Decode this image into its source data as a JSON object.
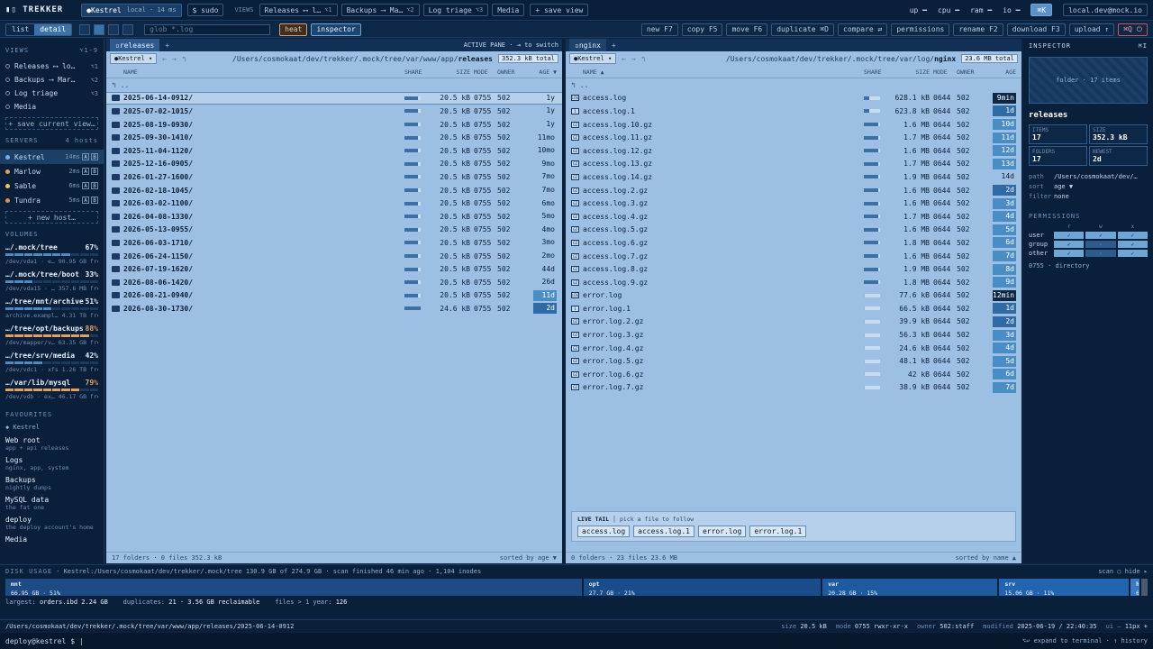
{
  "app": {
    "name": "TREKKER"
  },
  "topbar": {
    "host": "Kestrel",
    "host_mode": "local · 14 ms",
    "sudo": "$ sudo",
    "views_label": "VIEWS",
    "views": [
      {
        "label": "Releases ⟷ l…",
        "key": "⌥1"
      },
      {
        "label": "Backups ⟶ Ma…",
        "key": "⌥2"
      },
      {
        "label": "Log triage",
        "key": "⌥3"
      },
      {
        "label": "Media",
        "key": ""
      }
    ],
    "save_view": "+ save view",
    "meters": [
      "up",
      "cpu",
      "ram",
      "io"
    ],
    "cmdk": "⌘K",
    "account": "local.dev@mock.io"
  },
  "toolbar": {
    "modes": [
      "list",
      "detail"
    ],
    "glob_placeholder": "glob *.log",
    "heat": "heat",
    "inspector": "inspector",
    "actions": [
      "new F7",
      "copy F5",
      "move F6",
      "duplicate ⌘D",
      "compare ⇄",
      "permissions",
      "rename F2",
      "download F3",
      "upload ↑"
    ],
    "quit": "⌘Q ⏻"
  },
  "sidebar": {
    "views_title": "VIEWS",
    "views_keys": "⌥1-9",
    "views": [
      {
        "label": "Releases ⟷ lo…",
        "key": "⌥1"
      },
      {
        "label": "Backups ⟶ Mar…",
        "key": "⌥2"
      },
      {
        "label": "Log triage",
        "key": "⌥3"
      },
      {
        "label": "Media",
        "key": ""
      }
    ],
    "save_view": "+ save current view…",
    "servers_title": "SERVERS",
    "servers_count": "4 hosts",
    "servers": [
      {
        "name": "Kestrel",
        "lat": "14ms",
        "color": "#6fb0e8",
        "active": true
      },
      {
        "name": "Marlow",
        "lat": "2ms",
        "color": "#e0a060",
        "active": false
      },
      {
        "name": "Sable",
        "lat": "6ms",
        "color": "#e6c86e",
        "active": false
      },
      {
        "name": "Tundra",
        "lat": "5ms",
        "color": "#e08c5a",
        "active": false
      }
    ],
    "new_host": "+ new host…",
    "volumes_title": "VOLUMES",
    "volumes": [
      {
        "path": "…/.mock/tree",
        "pct": "67%",
        "fill": 0.67,
        "sub": "/dev/vda1 · e… 90.95 GB free",
        "color": "#4a8cc4",
        "warn": false
      },
      {
        "path": "…/.mock/tree/boot",
        "pct": "33%",
        "fill": 0.33,
        "sub": "/dev/vda15 · … 357.6 MB free",
        "color": "#4a8cc4",
        "warn": false
      },
      {
        "path": "…/tree/mnt/archive",
        "pct": "51%",
        "fill": 0.51,
        "sub": "archive.exampl… 4.31 TB free",
        "color": "#4a8cc4",
        "warn": false
      },
      {
        "path": "…/tree/opt/backups",
        "pct": "88%",
        "fill": 0.88,
        "sub": "/dev/mapper/v… 63.35 GB free",
        "color": "#e0a060",
        "warn": true
      },
      {
        "path": "…/tree/srv/media",
        "pct": "42%",
        "fill": 0.42,
        "sub": "/dev/vdc1 · xfs 1.26 TB free",
        "color": "#4a8cc4",
        "warn": false
      },
      {
        "path": "…/var/lib/mysql",
        "pct": "79%",
        "fill": 0.79,
        "sub": "/dev/vdb · ex… 46.17 GB free",
        "color": "#e0a060",
        "warn": true
      }
    ],
    "fav_title": "FAVOURITES",
    "fav_host": "◆ Kestrel",
    "favourites": [
      {
        "t": "Web root",
        "s": "app + api releases"
      },
      {
        "t": "Logs",
        "s": "nginx, app, system"
      },
      {
        "t": "Backups",
        "s": "nightly dumps"
      },
      {
        "t": "MySQL data",
        "s": "the fat one"
      },
      {
        "t": "deploy",
        "s": "the deploy account's home"
      },
      {
        "t": "Media",
        "s": ""
      }
    ]
  },
  "left": {
    "tab": "releases",
    "active_label": "ACTIVE PANE · ⇥ to switch",
    "host": "Kestrel",
    "path_prefix": "/Users/cosmokaat/dev/trekker/.mock/tree/var/www/app/",
    "path_leaf": "releases",
    "total": "352.3 kB total",
    "cols": {
      "name": "NAME",
      "share": "SHARE",
      "size": "SIZE",
      "mode": "MODE",
      "owner": "OWNER",
      "age": "AGE ▼"
    },
    "parent": "↰ ..",
    "rows": [
      {
        "n": "2025-06-14-0912/",
        "s": 0.85,
        "z": "20.5 kB",
        "m": "0755",
        "o": "502",
        "a": "1y",
        "h": "",
        "sel": true
      },
      {
        "n": "2025-07-02-1015/",
        "s": 0.85,
        "z": "20.5 kB",
        "m": "0755",
        "o": "502",
        "a": "1y",
        "h": ""
      },
      {
        "n": "2025-08-19-0930/",
        "s": 0.85,
        "z": "20.5 kB",
        "m": "0755",
        "o": "502",
        "a": "1y",
        "h": ""
      },
      {
        "n": "2025-09-30-1410/",
        "s": 0.85,
        "z": "20.5 kB",
        "m": "0755",
        "o": "502",
        "a": "11mo",
        "h": ""
      },
      {
        "n": "2025-11-04-1120/",
        "s": 0.85,
        "z": "20.5 kB",
        "m": "0755",
        "o": "502",
        "a": "10mo",
        "h": ""
      },
      {
        "n": "2025-12-16-0905/",
        "s": 0.85,
        "z": "20.5 kB",
        "m": "0755",
        "o": "502",
        "a": "9mo",
        "h": ""
      },
      {
        "n": "2026-01-27-1600/",
        "s": 0.85,
        "z": "20.5 kB",
        "m": "0755",
        "o": "502",
        "a": "7mo",
        "h": ""
      },
      {
        "n": "2026-02-18-1045/",
        "s": 0.85,
        "z": "20.5 kB",
        "m": "0755",
        "o": "502",
        "a": "7mo",
        "h": ""
      },
      {
        "n": "2026-03-02-1100/",
        "s": 0.85,
        "z": "20.5 kB",
        "m": "0755",
        "o": "502",
        "a": "6mo",
        "h": ""
      },
      {
        "n": "2026-04-08-1330/",
        "s": 0.85,
        "z": "20.5 kB",
        "m": "0755",
        "o": "502",
        "a": "5mo",
        "h": ""
      },
      {
        "n": "2026-05-13-0955/",
        "s": 0.85,
        "z": "20.5 kB",
        "m": "0755",
        "o": "502",
        "a": "4mo",
        "h": ""
      },
      {
        "n": "2026-06-03-1710/",
        "s": 0.85,
        "z": "20.5 kB",
        "m": "0755",
        "o": "502",
        "a": "3mo",
        "h": ""
      },
      {
        "n": "2026-06-24-1150/",
        "s": 0.85,
        "z": "20.5 kB",
        "m": "0755",
        "o": "502",
        "a": "2mo",
        "h": ""
      },
      {
        "n": "2026-07-19-1620/",
        "s": 0.85,
        "z": "20.5 kB",
        "m": "0755",
        "o": "502",
        "a": "44d",
        "h": ""
      },
      {
        "n": "2026-08-06-1420/",
        "s": 0.85,
        "z": "20.5 kB",
        "m": "0755",
        "o": "502",
        "a": "26d",
        "h": ""
      },
      {
        "n": "2026-08-21-0940/",
        "s": 0.85,
        "z": "20.5 kB",
        "m": "0755",
        "o": "502",
        "a": "11d",
        "h": "h2"
      },
      {
        "n": "2026-08-30-1730/",
        "s": 1.0,
        "z": "24.6 kB",
        "m": "0755",
        "o": "502",
        "a": "2d",
        "h": "h3"
      }
    ],
    "footer": "17 folders · 0 files  352.3 kB",
    "sort": "sorted by age ▼"
  },
  "right": {
    "tab": "nginx",
    "host": "Kestrel",
    "path_prefix": "/Users/cosmokaat/dev/trekker/.mock/tree/var/log/",
    "path_leaf": "nginx",
    "total": "23.6 MB total",
    "cols": {
      "name": "NAME ▲",
      "share": "SHARE",
      "size": "SIZE",
      "mode": "MODE",
      "owner": "OWNER",
      "age": "AGE"
    },
    "parent": "↰ ..",
    "rows": [
      {
        "n": "access.log",
        "s": 0.35,
        "z": "628.1 kB",
        "m": "0644",
        "o": "502",
        "a": "9min",
        "h": "h4",
        "i": "LOG"
      },
      {
        "n": "access.log.1",
        "s": 0.35,
        "z": "623.8 kB",
        "m": "0644",
        "o": "502",
        "a": "1d",
        "h": "h3",
        "i": "1"
      },
      {
        "n": "access.log.10.gz",
        "s": 0.9,
        "z": "1.6 MB",
        "m": "0644",
        "o": "502",
        "a": "10d",
        "h": "h2",
        "i": "GZ"
      },
      {
        "n": "access.log.11.gz",
        "s": 0.9,
        "z": "1.7 MB",
        "m": "0644",
        "o": "502",
        "a": "11d",
        "h": "h2",
        "i": "GZ"
      },
      {
        "n": "access.log.12.gz",
        "s": 0.9,
        "z": "1.6 MB",
        "m": "0644",
        "o": "502",
        "a": "12d",
        "h": "h2",
        "i": "GZ"
      },
      {
        "n": "access.log.13.gz",
        "s": 0.9,
        "z": "1.7 MB",
        "m": "0644",
        "o": "502",
        "a": "13d",
        "h": "h2",
        "i": "GZ"
      },
      {
        "n": "access.log.14.gz",
        "s": 0.9,
        "z": "1.9 MB",
        "m": "0644",
        "o": "502",
        "a": "14d",
        "h": "",
        "i": "GZ"
      },
      {
        "n": "access.log.2.gz",
        "s": 0.9,
        "z": "1.6 MB",
        "m": "0644",
        "o": "502",
        "a": "2d",
        "h": "h3",
        "i": "GZ"
      },
      {
        "n": "access.log.3.gz",
        "s": 0.9,
        "z": "1.6 MB",
        "m": "0644",
        "o": "502",
        "a": "3d",
        "h": "h2",
        "i": "GZ"
      },
      {
        "n": "access.log.4.gz",
        "s": 0.9,
        "z": "1.7 MB",
        "m": "0644",
        "o": "502",
        "a": "4d",
        "h": "h2",
        "i": "GZ"
      },
      {
        "n": "access.log.5.gz",
        "s": 0.9,
        "z": "1.6 MB",
        "m": "0644",
        "o": "502",
        "a": "5d",
        "h": "h2",
        "i": "GZ"
      },
      {
        "n": "access.log.6.gz",
        "s": 0.9,
        "z": "1.8 MB",
        "m": "0644",
        "o": "502",
        "a": "6d",
        "h": "h2",
        "i": "GZ"
      },
      {
        "n": "access.log.7.gz",
        "s": 0.9,
        "z": "1.6 MB",
        "m": "0644",
        "o": "502",
        "a": "7d",
        "h": "h2",
        "i": "GZ"
      },
      {
        "n": "access.log.8.gz",
        "s": 0.9,
        "z": "1.9 MB",
        "m": "0644",
        "o": "502",
        "a": "8d",
        "h": "h2",
        "i": "GZ"
      },
      {
        "n": "access.log.9.gz",
        "s": 0.9,
        "z": "1.8 MB",
        "m": "0644",
        "o": "502",
        "a": "9d",
        "h": "h2",
        "i": "GZ"
      },
      {
        "n": "error.log",
        "s": 0.08,
        "z": "77.6 kB",
        "m": "0644",
        "o": "502",
        "a": "12min",
        "h": "h4",
        "i": "LOG"
      },
      {
        "n": "error.log.1",
        "s": 0.08,
        "z": "66.5 kB",
        "m": "0644",
        "o": "502",
        "a": "1d",
        "h": "h3",
        "i": "1"
      },
      {
        "n": "error.log.2.gz",
        "s": 0.08,
        "z": "39.9 kB",
        "m": "0644",
        "o": "502",
        "a": "2d",
        "h": "h3",
        "i": "GZ"
      },
      {
        "n": "error.log.3.gz",
        "s": 0.08,
        "z": "56.3 kB",
        "m": "0644",
        "o": "502",
        "a": "3d",
        "h": "h2",
        "i": "GZ"
      },
      {
        "n": "error.log.4.gz",
        "s": 0.08,
        "z": "24.6 kB",
        "m": "0644",
        "o": "502",
        "a": "4d",
        "h": "h2",
        "i": "GZ"
      },
      {
        "n": "error.log.5.gz",
        "s": 0.08,
        "z": "48.1 kB",
        "m": "0644",
        "o": "502",
        "a": "5d",
        "h": "h2",
        "i": "GZ"
      },
      {
        "n": "error.log.6.gz",
        "s": 0.08,
        "z": "42 kB",
        "m": "0644",
        "o": "502",
        "a": "6d",
        "h": "h2",
        "i": "GZ"
      },
      {
        "n": "error.log.7.gz",
        "s": 0.08,
        "z": "38.9 kB",
        "m": "0644",
        "o": "502",
        "a": "7d",
        "h": "h2",
        "i": "GZ"
      }
    ],
    "livetail": {
      "title": "LIVE TAIL",
      "hint": "pick a file to follow",
      "files": [
        "access.log",
        "access.log.1",
        "error.log",
        "error.log.1"
      ]
    },
    "footer": "0 folders · 23 files  23.6 MB",
    "sort": "sorted by name ▲"
  },
  "inspector": {
    "title": "INSPECTOR",
    "key": "⌘I",
    "preview": "folder · 17 items",
    "name": "releases",
    "stats": [
      {
        "l": "ITEMS",
        "v": "17"
      },
      {
        "l": "SIZE",
        "v": "352.3 kB"
      },
      {
        "l": "FOLDERS",
        "v": "17"
      },
      {
        "l": "NEWEST",
        "v": "2d"
      }
    ],
    "path_k": "path",
    "path_v": "/Users/cosmokaat/dev/…",
    "sort_k": "sort",
    "sort_v": "age ▼",
    "filter_k": "filter",
    "filter_v": "none",
    "perm_title": "PERMISSIONS",
    "perm_cols": [
      "r",
      "w",
      "x"
    ],
    "perms": [
      {
        "who": "user",
        "r": "✓",
        "w": "✓",
        "x": "✓"
      },
      {
        "who": "group",
        "r": "✓",
        "w": "·",
        "x": "✓"
      },
      {
        "who": "other",
        "r": "✓",
        "w": "·",
        "x": "✓"
      }
    ],
    "mode_summary": "0755 · directory"
  },
  "disk": {
    "title": "DISK USAGE",
    "info": "· Kestrel:/Users/cosmokaat/dev/trekker/.mock/tree  130.9 GB of 274.9 GB · scan finished 46 min ago · 1,104 inodes",
    "ctrl": "scan ○  hide ▸",
    "blocks": [
      {
        "n": "mnt",
        "s": "66.95 GB · 51%",
        "w": 0.51,
        "c": "#1e4a86"
      },
      {
        "n": "opt",
        "s": "27.7 GB · 21%",
        "w": 0.21,
        "c": "#1a4b8a"
      },
      {
        "n": "var",
        "s": "20.28 GB · 15%",
        "w": 0.155,
        "c": "#1d5a9e"
      },
      {
        "n": "srv",
        "s": "15.06 GB · 11%",
        "w": 0.115,
        "c": "#2364b0"
      },
      {
        "n": "h…",
        "s": "6…",
        "w": 0.008,
        "c": "#3a7ac2"
      },
      {
        "n": "·",
        "s": "·",
        "w": 0.006,
        "c": "#4a5a70"
      }
    ],
    "largest_k": "largest:",
    "largest_v": "orders.ibd 2.24 GB",
    "dup_k": "duplicates:",
    "dup_v": "21 · 3.56 GB reclaimable",
    "old_k": "files > 1 year:",
    "old_v": "126"
  },
  "status": {
    "path": "/Users/cosmokaat/dev/trekker/.mock/tree/var/www/app/releases/2025-06-14-0912",
    "size": "20.5 kB",
    "mode": "0755 rwxr-xr-x",
    "owner": "502:staff",
    "modified": "2025-06-19 / 22:40:35",
    "ui": "11px +"
  },
  "terminal": {
    "prompt": "deploy@kestrel $",
    "hint": "⌥↩ expand to terminal · ↑ history"
  }
}
